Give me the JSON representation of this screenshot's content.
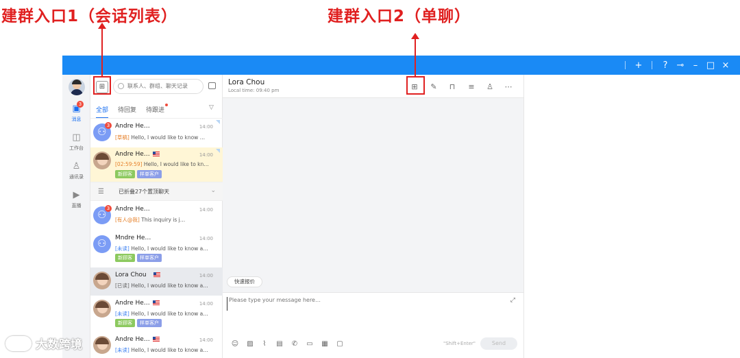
{
  "annotations": {
    "label_1": "建群入口1（会话列表）",
    "label_2": "建群入口2（单聊）"
  },
  "titlebar": {
    "buttons": [
      "+",
      "?",
      "pin",
      "–",
      "□",
      "×"
    ],
    "accent": "#1a8af5"
  },
  "rail": {
    "items": [
      {
        "label": "消息",
        "icon": "message-icon",
        "badge": "3",
        "active": true
      },
      {
        "label": "工作台",
        "icon": "workbench-icon"
      },
      {
        "label": "通讯录",
        "icon": "contacts-icon"
      },
      {
        "label": "直播",
        "icon": "live-icon"
      }
    ]
  },
  "list": {
    "search_placeholder": "联系人、群组、聊天记录",
    "tabs": [
      "全部",
      "待回复",
      "待跟进"
    ],
    "folded_text": "已折叠27个置顶聊天",
    "items": [
      {
        "name": "Andre He…",
        "time": "14:00",
        "badge": "3",
        "prefix": "[草稿]",
        "text": " Hello, I would like to know …",
        "type": "group"
      },
      {
        "name": "Andre He…",
        "time": "14:00",
        "prefix": "[02:59:59]",
        "text": " Hello, I would like to kn…",
        "tags": [
          "新顾客",
          "样单客户"
        ],
        "type": "photo",
        "flag": true
      },
      {
        "name": "Andre He…",
        "time": "14:00",
        "badge": "3",
        "prefix": "[有人@我]",
        "text": " This inquiry is j…",
        "type": "group"
      },
      {
        "name": "Mndre He…",
        "time": "14:00",
        "prefix": "[未读]",
        "text": " Hello, I would like to know a…",
        "tags": [
          "新顾客",
          "样单客户"
        ],
        "type": "group"
      },
      {
        "name": "Lora Chou",
        "time": "14:00",
        "prefix": "[已读]",
        "text": " Hello, I would like to know a…",
        "type": "photo",
        "flag": true
      },
      {
        "name": "Andre He…",
        "time": "14:00",
        "prefix": "[未读]",
        "text": " Hello, I would like to know a…",
        "tags": [
          "新顾客",
          "样单客户"
        ],
        "type": "photo",
        "flag": true
      },
      {
        "name": "Andre He…",
        "time": "14:00",
        "prefix": "[未读]",
        "text": " Hello, I would like to know a…",
        "type": "photo",
        "flag": true
      }
    ]
  },
  "chat": {
    "name": "Lora Chou",
    "local_time": "Local time: 09:40 pm",
    "quick_reply": "快速报价",
    "placeholder": "Please type your message here…",
    "shortcut": "\"Shift+Enter\"",
    "send": "Send"
  },
  "watermark": "大数跨境"
}
